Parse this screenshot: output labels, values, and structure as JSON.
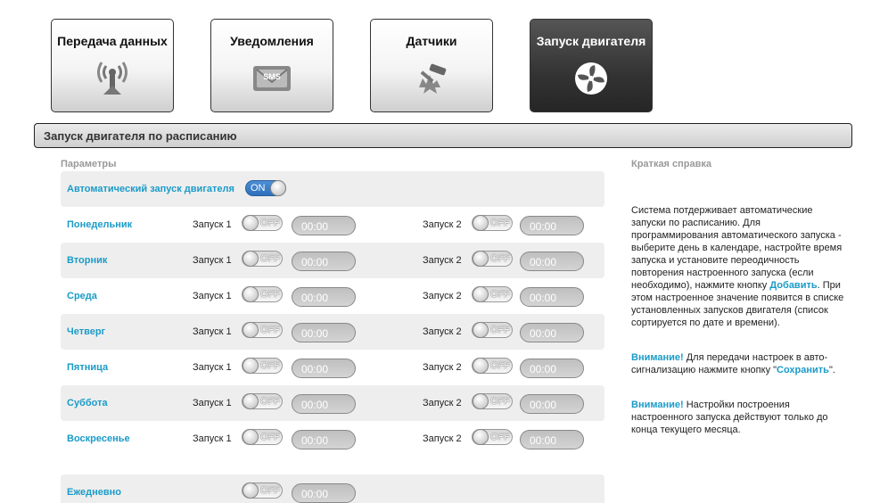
{
  "tabs": [
    {
      "label": "Передача данных",
      "icon": "antenna-icon"
    },
    {
      "label": "Уведомления",
      "icon": "sms-icon"
    },
    {
      "label": "Датчики",
      "icon": "sensor-hammer-icon"
    },
    {
      "label": "Запуск двигателя",
      "icon": "fan-icon",
      "active": true
    }
  ],
  "section_title": "Запуск двигателя по расписанию",
  "params_label": "Параметры",
  "auto_start": {
    "label": "Автоматический запуск двигателя",
    "state": "ON"
  },
  "launch1_label": "Запуск 1",
  "launch2_label": "Запуск 2",
  "off_label": "OFF",
  "time_value": "00:00",
  "days": [
    {
      "name": "Понедельник"
    },
    {
      "name": "Вторник"
    },
    {
      "name": "Среда"
    },
    {
      "name": "Четверг"
    },
    {
      "name": "Пятница"
    },
    {
      "name": "Суббота"
    },
    {
      "name": "Воскресенье"
    }
  ],
  "daily": {
    "name": "Ежедневно"
  },
  "help": {
    "title": "Краткая справка",
    "p1_part1": "Система потдерживает автоматические запуски по расписанию. Для программирования автоматического запуска - выберите день в календаре, настройте время запуска и установите переодичность повторения настроенного запуска (если необходимо), нажмите кнопку ",
    "p1_link": "Добавить",
    "p1_part2": ". При этом настроенное значение появится в списке установленных запусков двигателя (список сортируется по дате и времени).",
    "p2_warn": "Внимание!",
    "p2_part1": " Для передачи настроек в авто-сигнализацию нажмите кнопку \"",
    "p2_link": "Сохранить",
    "p2_part2": "\".",
    "p3_warn": "Внимание!",
    "p3_part1": " Настройки построения настроенного запуска действуют только до конца текущего месяца."
  },
  "colors": {
    "accent": "#1a9bc8",
    "active_tab": "#333333",
    "toggle_on": "#2e6fbc"
  }
}
